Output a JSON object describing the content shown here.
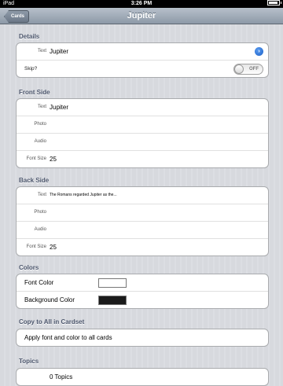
{
  "status_bar": {
    "carrier": "iPad",
    "time": "3:26 PM",
    "battery_level": 0.95
  },
  "nav": {
    "title": "Jupiter",
    "back_label": "Cards"
  },
  "details": {
    "header": "Details",
    "text_label": "Text",
    "text_value": "Jupiter",
    "skip_label": "Skip?",
    "skip_state": "OFF"
  },
  "front_side": {
    "header": "Front Side",
    "text_label": "Text",
    "text_value": "Jupiter",
    "photo_label": "Photo",
    "audio_label": "Audio",
    "font_size_label": "Font Size",
    "font_size_value": "25"
  },
  "back_side": {
    "header": "Back Side",
    "text_label": "Text",
    "text_value": "The Romans regarded Jupiter as the...",
    "photo_label": "Photo",
    "audio_label": "Audio",
    "font_size_label": "Font Size",
    "font_size_value": "25"
  },
  "colors": {
    "header": "Colors",
    "font_color_label": "Font Color",
    "font_color": "#ffffff",
    "background_color_label": "Background Color",
    "background_color": "#1a1a1a"
  },
  "copy_all": {
    "header": "Copy to All in Cardset",
    "action_label": "Apply font and color to all cards"
  },
  "topics": {
    "header": "Topics",
    "value": "0 Topics"
  }
}
